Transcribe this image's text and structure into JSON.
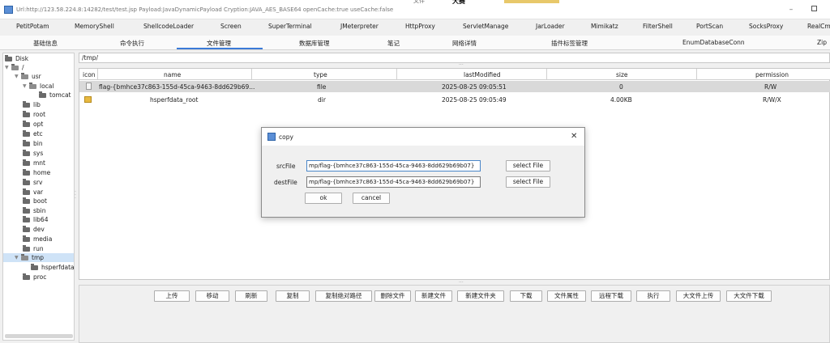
{
  "window": {
    "title": "Url:http://123.58.224.8:14282/test/test.jsp Payload:JavaDynamicPayload Cryption:JAVA_AES_BASE64 openCache:true useCache:false",
    "bg_text_a": "文件",
    "bg_text_b": "大赛",
    "minimize": "–"
  },
  "plugin_tabs": [
    "PetitPotam",
    "MemoryShell",
    "ShellcodeLoader",
    "Screen",
    "SuperTerminal",
    "JMeterpreter",
    "HttpProxy",
    "ServletManage",
    "JarLoader",
    "Mimikatz",
    "FilterShell",
    "PortScan",
    "SocksProxy",
    "RealCm"
  ],
  "main_tabs": [
    "基础信息",
    "命令执行",
    "文件管理",
    "数据库管理",
    "笔记",
    "网络详情",
    "插件标签管理",
    "EnumDatabaseConn",
    "Zip"
  ],
  "active_tab": "文件管理",
  "tree": [
    {
      "label": "Disk",
      "caret": ""
    },
    {
      "label": "/",
      "caret": "▼"
    },
    {
      "label": "usr",
      "caret": "▼"
    },
    {
      "label": "local",
      "caret": "▼"
    },
    {
      "label": "tomcat",
      "caret": ""
    },
    {
      "label": "lib",
      "caret": ""
    },
    {
      "label": "root",
      "caret": ""
    },
    {
      "label": "opt",
      "caret": ""
    },
    {
      "label": "etc",
      "caret": ""
    },
    {
      "label": "bin",
      "caret": ""
    },
    {
      "label": "sys",
      "caret": ""
    },
    {
      "label": "mnt",
      "caret": ""
    },
    {
      "label": "home",
      "caret": ""
    },
    {
      "label": "srv",
      "caret": ""
    },
    {
      "label": "var",
      "caret": ""
    },
    {
      "label": "boot",
      "caret": ""
    },
    {
      "label": "sbin",
      "caret": ""
    },
    {
      "label": "lib64",
      "caret": ""
    },
    {
      "label": "dev",
      "caret": ""
    },
    {
      "label": "media",
      "caret": ""
    },
    {
      "label": "run",
      "caret": ""
    },
    {
      "label": "tmp",
      "caret": "▼"
    },
    {
      "label": "hsperfdata",
      "caret": ""
    },
    {
      "label": "proc",
      "caret": ""
    }
  ],
  "current_path": "/tmp/",
  "table": {
    "headers": [
      "icon",
      "name",
      "type",
      "lastModified",
      "size",
      "permission"
    ],
    "rows": [
      {
        "icon": "file-icon",
        "name": "flag-{bmhce37c863-155d-45ca-9463-8dd629b69...",
        "type": "file",
        "lastModified": "2025-08-25 09:05:51",
        "size": "0",
        "permission": "R/W"
      },
      {
        "icon": "folder-icon",
        "name": "hsperfdata_root",
        "type": "dir",
        "lastModified": "2025-08-25 09:05:49",
        "size": "4.00KB",
        "permission": "R/W/X"
      }
    ]
  },
  "buttons": [
    "上传",
    "移动",
    "刷新",
    "复制",
    "复制绝对路径",
    "删除文件",
    "新建文件",
    "新建文件夹",
    "下载",
    "文件属性",
    "远程下载",
    "执行",
    "大文件上传",
    "大文件下载"
  ],
  "dialog": {
    "title": "copy",
    "close": "✕",
    "src_label": "srcFile",
    "src_value": "mp/flag-{bmhce37c863-155d-45ca-9463-8dd629b69b07}",
    "dest_label": "destFile",
    "dest_value": "mp/flag-{bmhce37c863-155d-45ca-9463-8dd629b69b07}",
    "select_file_label": "select File",
    "ok_label": "ok",
    "cancel_label": "cancel"
  }
}
